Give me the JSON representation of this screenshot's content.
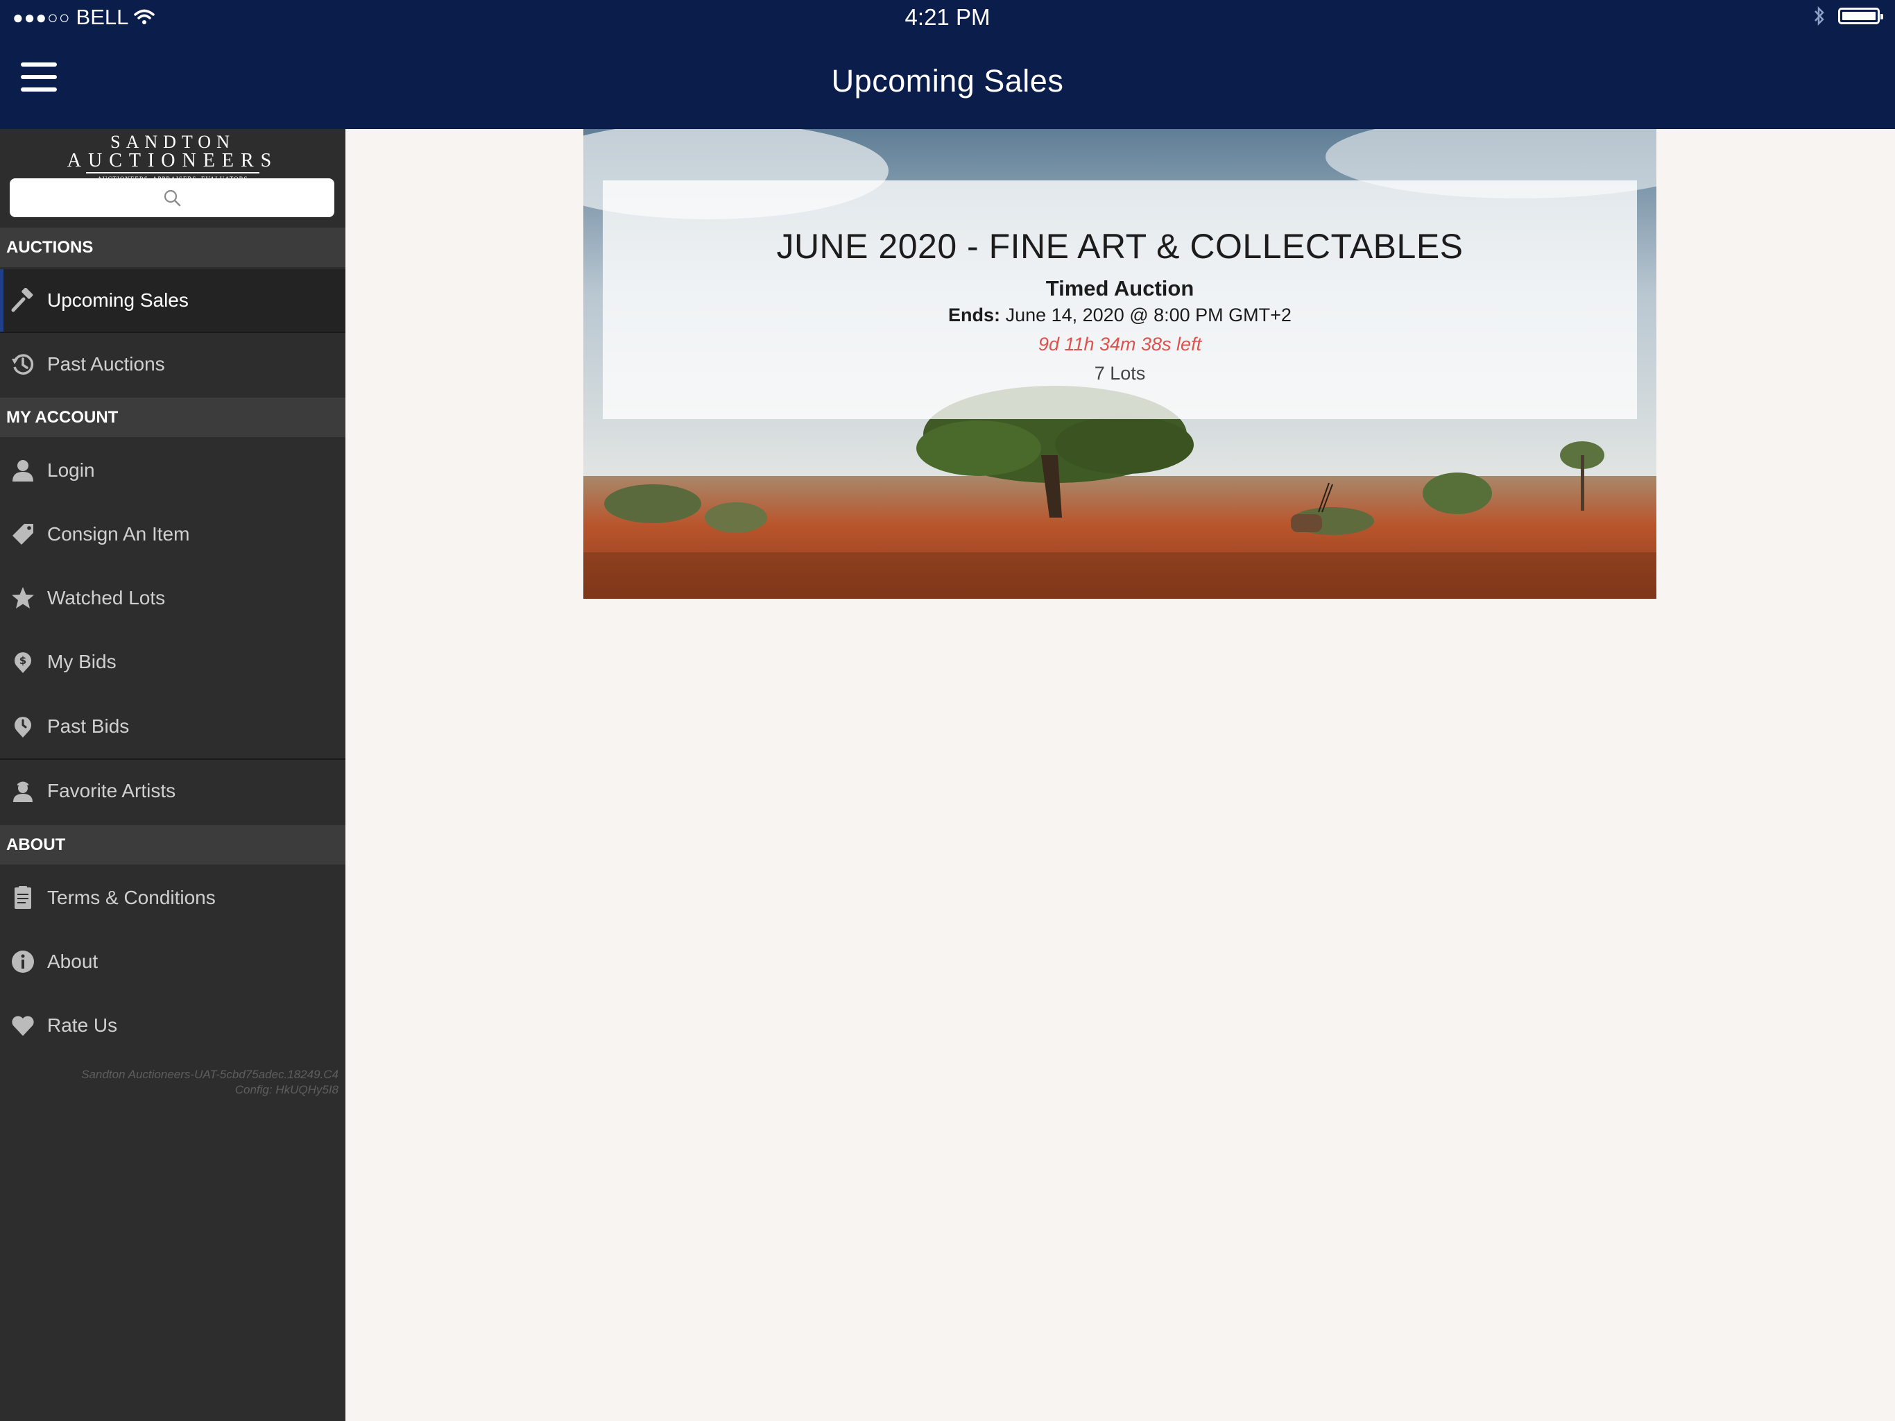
{
  "status_bar": {
    "carrier": "BELL",
    "time": "4:21 PM"
  },
  "header": {
    "title": "Upcoming Sales"
  },
  "sidebar": {
    "logo": {
      "line1": "SANDTON",
      "line2": "AUCTIONEERS",
      "tagline": "AUCTIONEERS, APPRAISERS, EVALUATORS"
    },
    "search": {
      "placeholder": ""
    },
    "sections": {
      "auctions": "AUCTIONS",
      "my_account": "MY ACCOUNT",
      "about": "ABOUT"
    },
    "items": {
      "upcoming_sales": "Upcoming Sales",
      "past_auctions": "Past Auctions",
      "login": "Login",
      "consign": "Consign An Item",
      "watched": "Watched Lots",
      "my_bids": "My Bids",
      "past_bids": "Past Bids",
      "favorite_artists": "Favorite Artists",
      "terms": "Terms & Conditions",
      "about": "About",
      "rate": "Rate Us"
    },
    "build_line1": "Sandton Auctioneers-UAT-5cbd75adec.18249.C4",
    "build_line2": "Config: HkUQHy5I8"
  },
  "auction": {
    "title": "JUNE 2020 - FINE ART & COLLECTABLES",
    "type": "Timed Auction",
    "ends_label": "Ends:",
    "ends_value": "June 14, 2020 @ 8:00 PM GMT+2",
    "time_left": "9d 11h 34m 38s left",
    "lots": "7 Lots"
  },
  "colors": {
    "header_bg": "#0b1d4b",
    "sidebar_bg": "#2d2d2d",
    "countdown": "#e0514d",
    "page_bg": "#f7f4f1"
  }
}
